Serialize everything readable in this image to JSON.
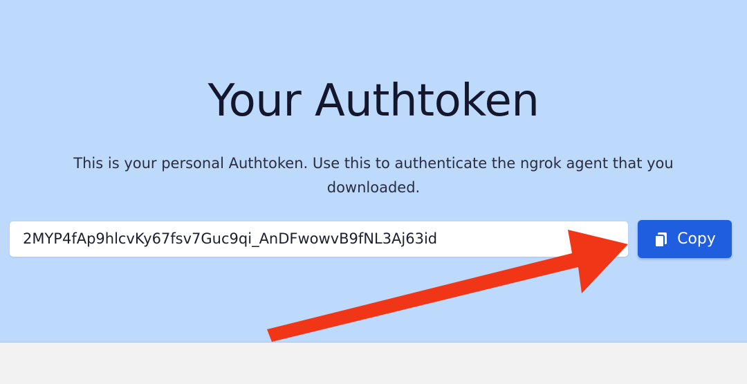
{
  "hero": {
    "title": "Your Authtoken",
    "description": "This is your personal Authtoken. Use this to authenticate the ngrok agent that you downloaded."
  },
  "token": {
    "value": "2MYP4fAp9hlcvKy67fsv7Guc9qi_AnDFwowvB9fNL3Aj63id"
  },
  "copy_button": {
    "label": "Copy",
    "icon": "copy-icon"
  },
  "annotation": {
    "arrow_color": "#f03617"
  },
  "colors": {
    "hero_background": "#bdd9fc",
    "button": "#1f5fdf",
    "title": "#14162c"
  }
}
